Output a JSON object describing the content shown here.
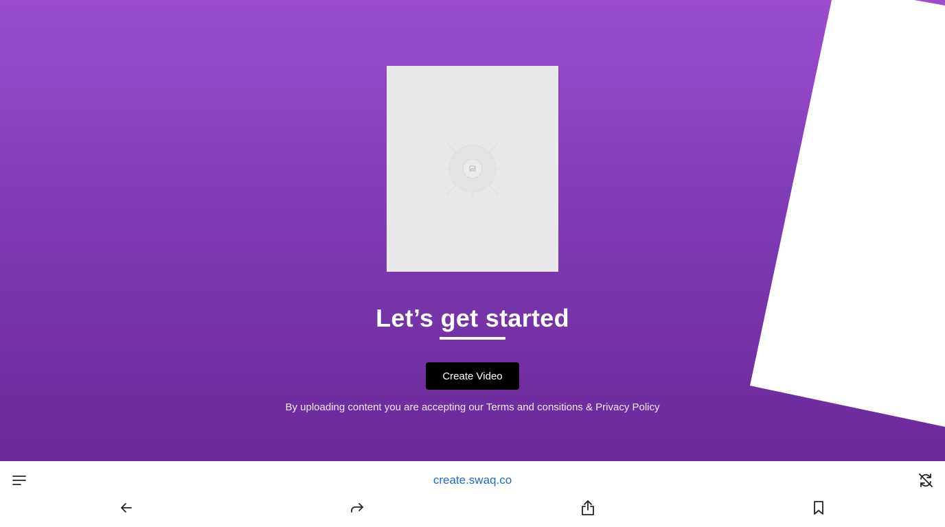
{
  "hero": {
    "headline": "Let’s get started",
    "create_button_label": "Create Video",
    "terms_text": "By uploading content you are accepting our Terms and consitions & Privacy Policy",
    "background_top_color": "#9b4dce",
    "background_bottom_color": "#6a2a99"
  },
  "preview": {
    "icon": "image-placeholder-icon"
  },
  "browser_bar": {
    "url": "create.swaq.co",
    "url_color": "#1a6bc8",
    "icons": {
      "menu": "menu-icon",
      "refresh": "sync-off-icon",
      "back": "back-arrow-icon",
      "forward": "forward-arrow-icon",
      "share": "share-icon",
      "bookmark": "bookmark-icon"
    }
  }
}
